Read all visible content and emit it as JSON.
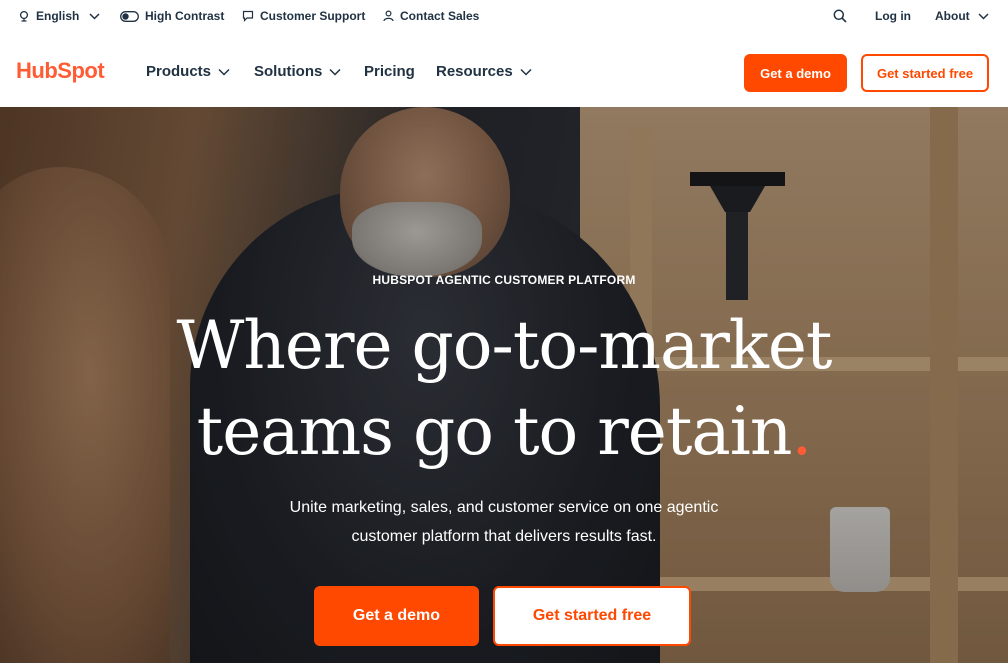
{
  "utility_bar": {
    "language": "English",
    "high_contrast": "High Contrast",
    "customer_support": "Customer Support",
    "contact_sales": "Contact Sales",
    "log_in": "Log in",
    "about": "About"
  },
  "nav": {
    "logo_text": "HubSpot",
    "items": [
      {
        "label": "Products",
        "has_dropdown": true
      },
      {
        "label": "Solutions",
        "has_dropdown": true
      },
      {
        "label": "Pricing",
        "has_dropdown": false
      },
      {
        "label": "Resources",
        "has_dropdown": true
      }
    ],
    "demo_button": "Get a demo",
    "free_button": "Get started free"
  },
  "hero": {
    "eyebrow": "HUBSPOT AGENTIC CUSTOMER PLATFORM",
    "headline_line1": "Where go-to-market",
    "headline_line2": "teams go to retain",
    "headline_dot": ".",
    "subhead_line1": "Unite marketing, sales, and customer service on one agentic",
    "subhead_line2": "customer platform that delivers results fast.",
    "demo_button": "Get a demo",
    "free_button": "Get started free"
  },
  "colors": {
    "brand_orange": "#ff4800",
    "logo_orange": "#ff5c35",
    "text_dark": "#213343"
  },
  "icons": [
    "globe-icon",
    "toggle-icon",
    "chat-icon",
    "person-icon",
    "search-icon",
    "chevron-down-icon"
  ]
}
